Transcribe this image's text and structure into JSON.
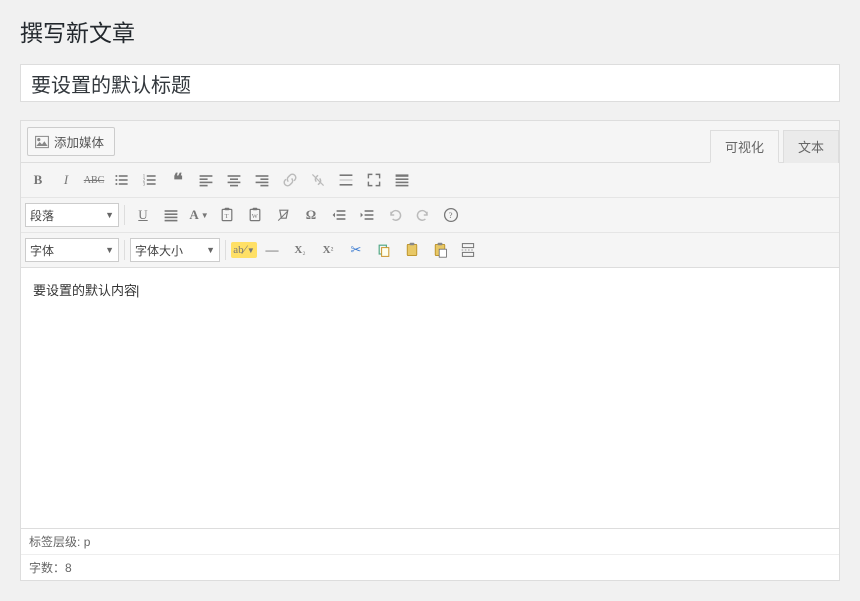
{
  "page": {
    "title": "撰写新文章"
  },
  "post": {
    "title_value": "要设置的默认标题"
  },
  "editor": {
    "add_media_label": "添加媒体",
    "tab_visual": "可视化",
    "tab_text": "文本",
    "paragraph_select": "段落",
    "font_select": "字体",
    "fontsize_select": "字体大小",
    "content": "要设置的默认内容"
  },
  "status": {
    "path_label": "标签层级:",
    "path_value": "p",
    "words_label": "字数：",
    "words_value": "8"
  }
}
